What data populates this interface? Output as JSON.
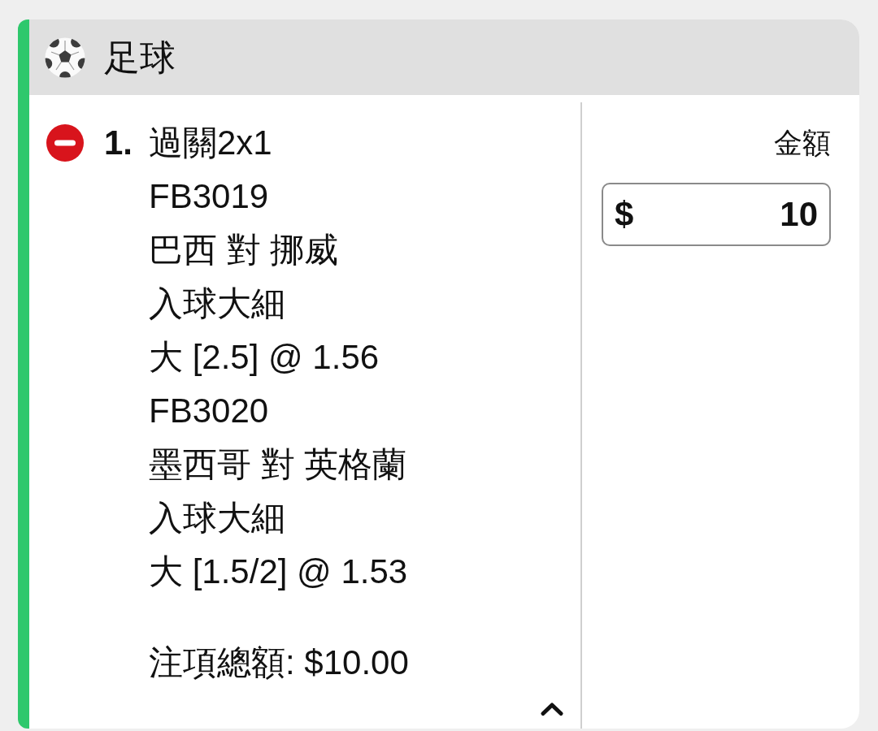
{
  "section": {
    "title": "足球"
  },
  "bet": {
    "number": "1.",
    "type": "過關2x1",
    "expanded": true,
    "legs": [
      {
        "event_code": "FB3019",
        "match": "巴西 對 挪威",
        "market": "入球大細",
        "selection": "大 [2.5] @ 1.56"
      },
      {
        "event_code": "FB3020",
        "match": "墨西哥 對 英格蘭",
        "market": "入球大細",
        "selection": "大 [1.5/2] @ 1.53"
      }
    ],
    "total": "注項總額: $10.00"
  },
  "stake": {
    "label": "金額",
    "currency": "$",
    "value": "10"
  }
}
